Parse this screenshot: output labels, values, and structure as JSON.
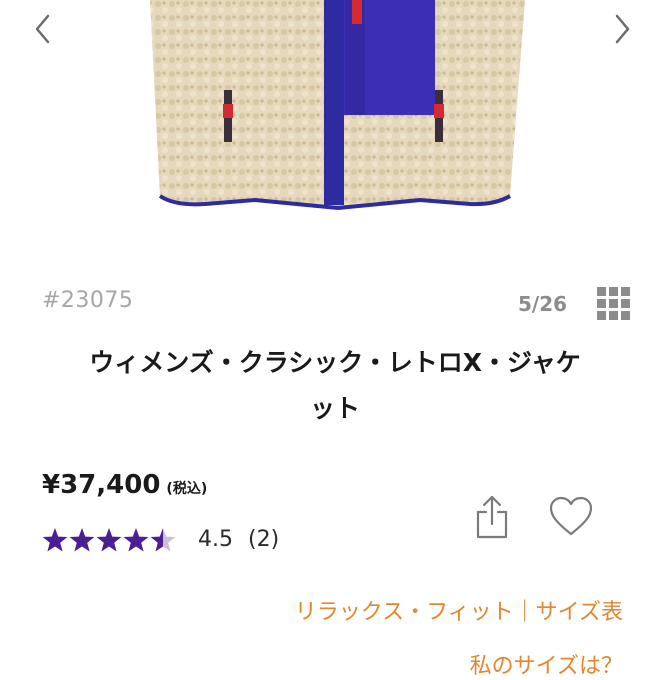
{
  "product": {
    "sku": "#23075",
    "title_line1": "ウィメンズ・クラシック・レトロX・ジャケ",
    "title_line2": "ット",
    "price": "¥37,400",
    "tax_note": "(税込)",
    "rating": 4.5,
    "rating_value": "4.5",
    "rating_count": "(2)"
  },
  "gallery": {
    "counter": "5/26",
    "prev_icon": "chevron-left-icon",
    "next_icon": "chevron-right-icon",
    "grid_icon": "grid-icon"
  },
  "actions": {
    "share_icon": "share-icon",
    "favorite_icon": "heart-icon"
  },
  "links": {
    "fit_guide": "リラックス・フィット｜サイズ表",
    "my_size": "私のサイズは？"
  },
  "colors": {
    "star": "#4b1e91",
    "link": "#e3862e",
    "fleece": "#e6d8bd",
    "panel": "#3b30b5"
  }
}
